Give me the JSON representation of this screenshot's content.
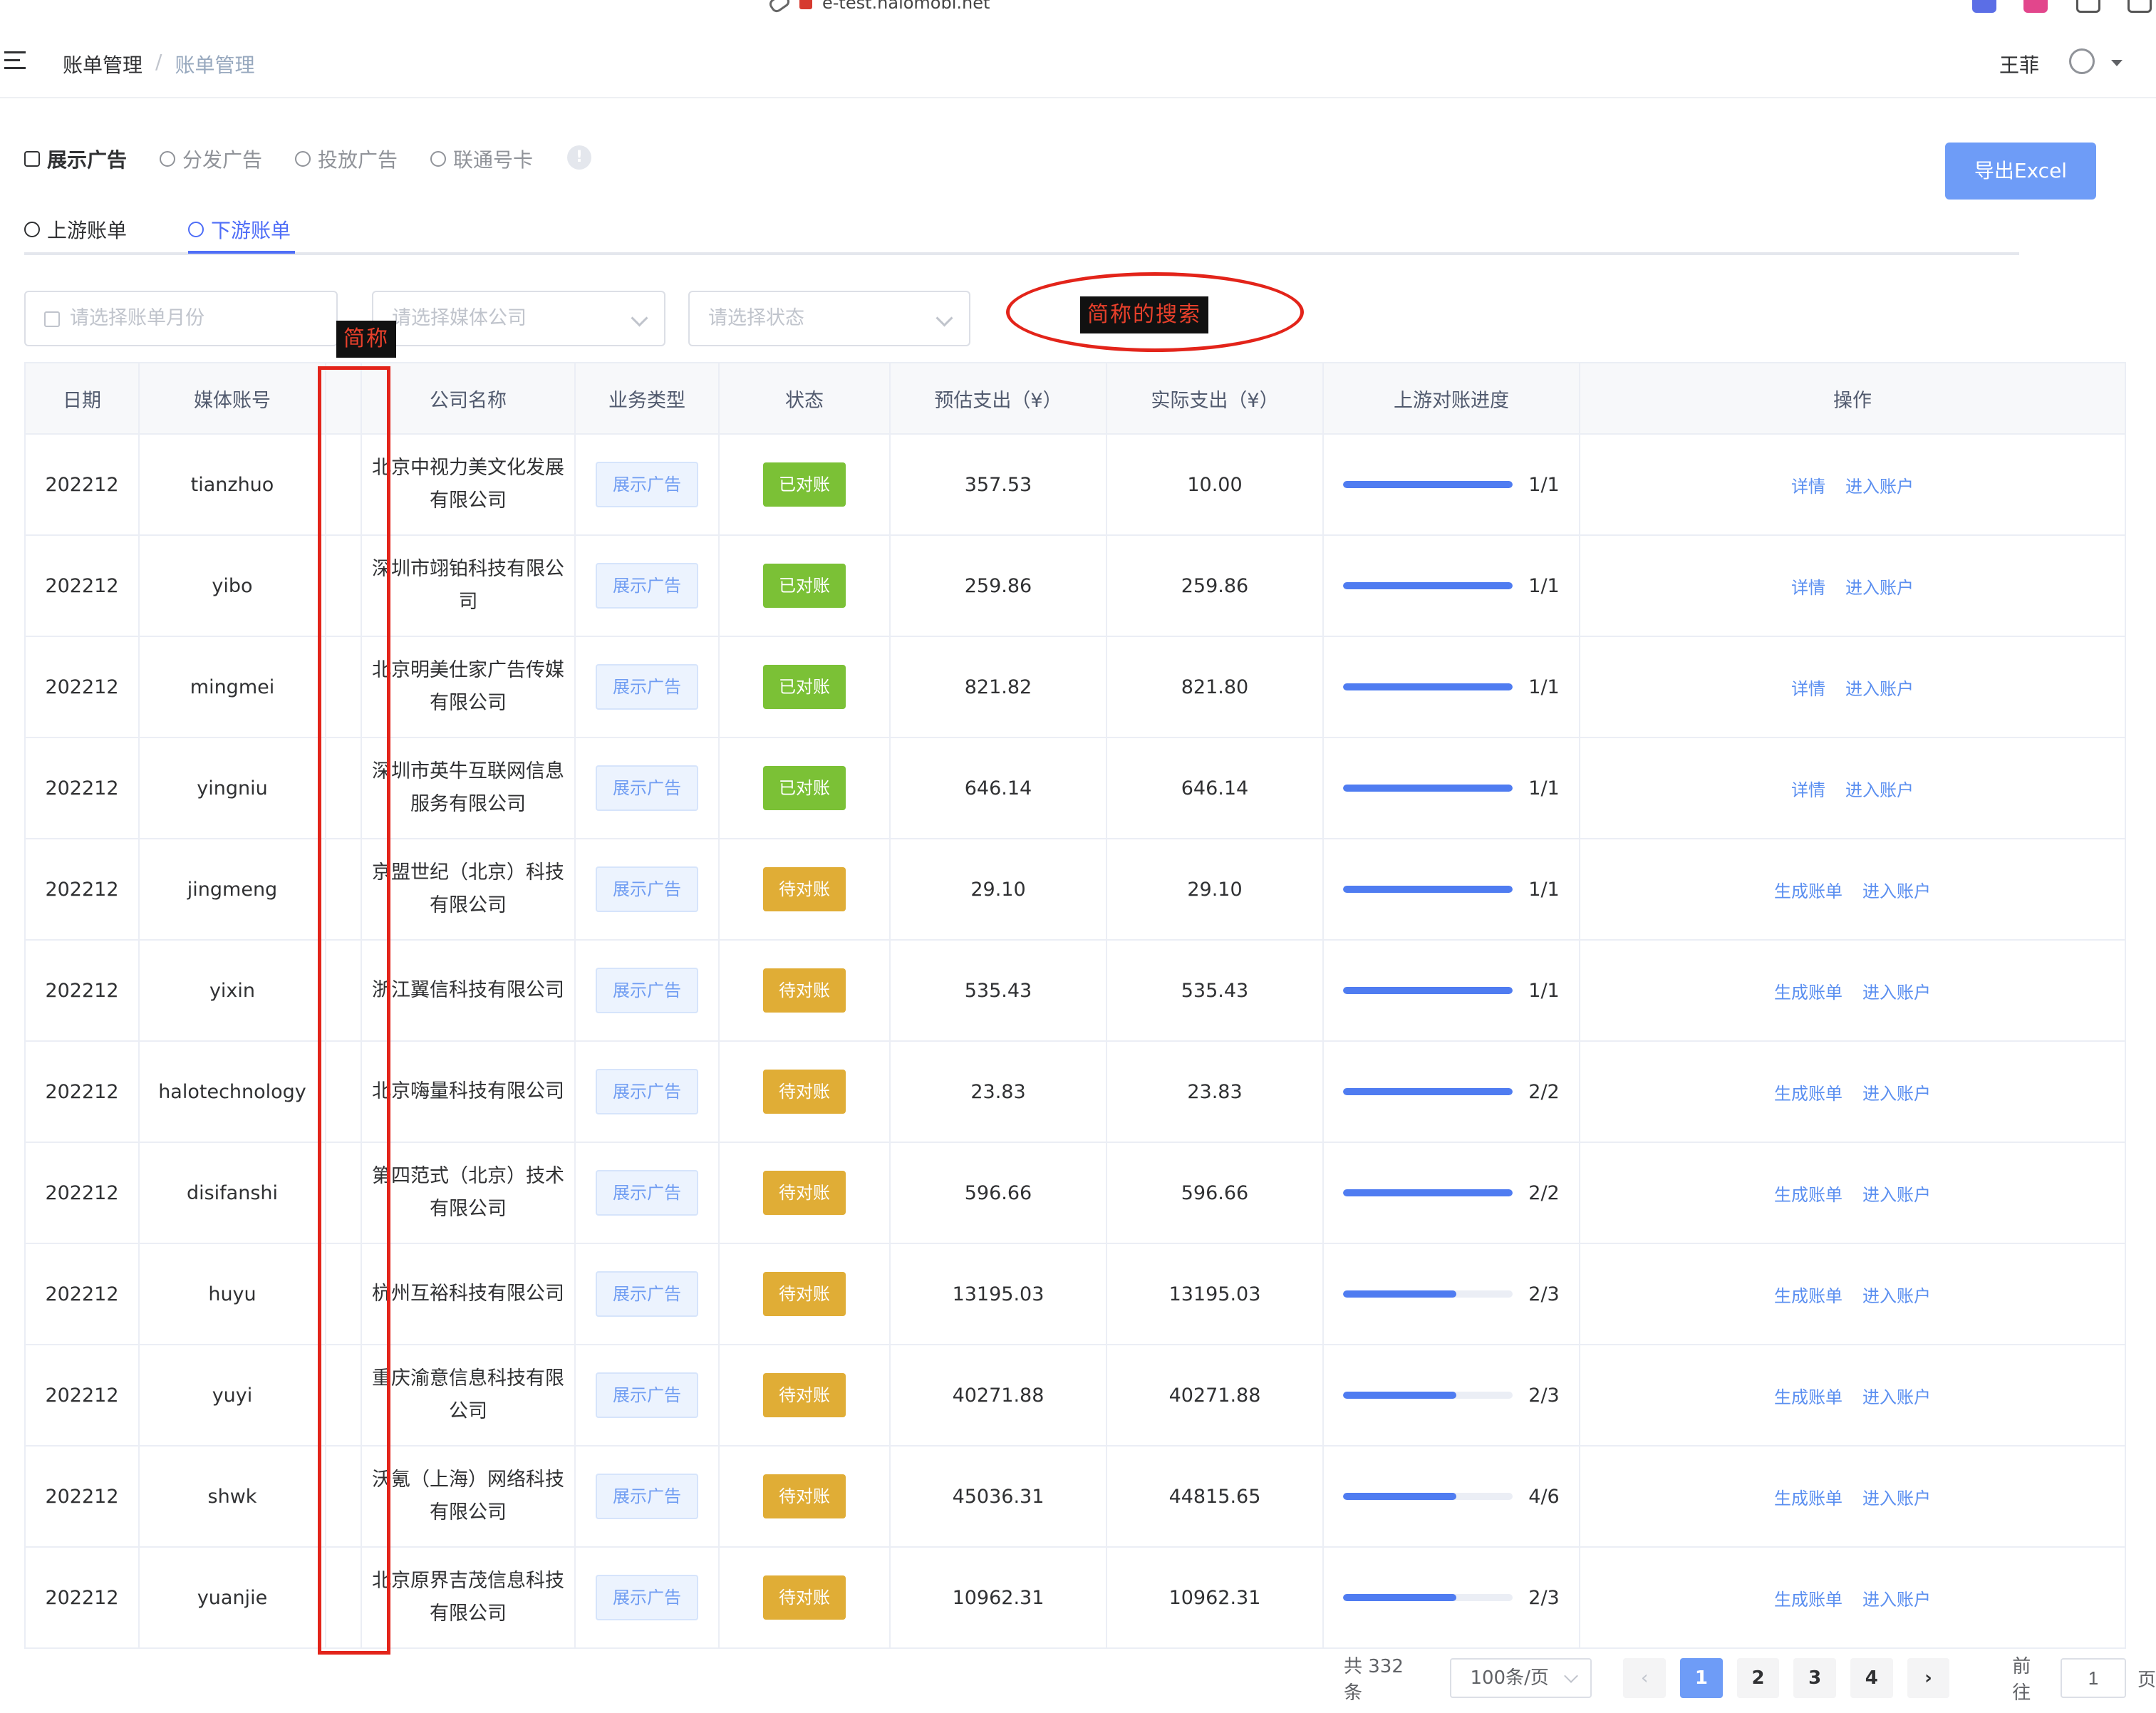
{
  "browser": {
    "url": "e-test.halomobi.net"
  },
  "header": {
    "breadcrumb": [
      "账单管理",
      "账单管理"
    ],
    "user_name": "王菲"
  },
  "top_tabs": [
    "展示广告",
    "分发广告",
    "投放广告",
    "联通号卡"
  ],
  "export_label": "导出Excel",
  "sub_tabs": [
    "上游账单",
    "下游账单"
  ],
  "filters": {
    "month_placeholder": "请选择账单月份",
    "media_placeholder": "请选择媒体公司",
    "status_placeholder": "请选择状态"
  },
  "annotations": {
    "search_label": "简称的搜索",
    "column_label": "简称"
  },
  "table": {
    "headers": [
      "日期",
      "媒体账号",
      "",
      "公司名称",
      "业务类型",
      "状态",
      "预估支出（¥）",
      "实际支出（¥）",
      "上游对账进度",
      "操作"
    ],
    "rows": [
      {
        "date": "202212",
        "account": "tianzhuo",
        "short": "",
        "company": "北京中视力美文化发展有限公司",
        "biz": "展示广告",
        "status": "已对账",
        "est": "357.53",
        "actual": "10.00",
        "progress": "1/1",
        "progress_ratio": 1.0,
        "ops": [
          "详情",
          "进入账户"
        ]
      },
      {
        "date": "202212",
        "account": "yibo",
        "short": "",
        "company": "深圳市翊铂科技有限公司",
        "biz": "展示广告",
        "status": "已对账",
        "est": "259.86",
        "actual": "259.86",
        "progress": "1/1",
        "progress_ratio": 1.0,
        "ops": [
          "详情",
          "进入账户"
        ]
      },
      {
        "date": "202212",
        "account": "mingmei",
        "short": "",
        "company": "北京明美仕家广告传媒有限公司",
        "biz": "展示广告",
        "status": "已对账",
        "est": "821.82",
        "actual": "821.80",
        "progress": "1/1",
        "progress_ratio": 1.0,
        "ops": [
          "详情",
          "进入账户"
        ]
      },
      {
        "date": "202212",
        "account": "yingniu",
        "short": "",
        "company": "深圳市英牛互联网信息服务有限公司",
        "biz": "展示广告",
        "status": "已对账",
        "est": "646.14",
        "actual": "646.14",
        "progress": "1/1",
        "progress_ratio": 1.0,
        "ops": [
          "详情",
          "进入账户"
        ]
      },
      {
        "date": "202212",
        "account": "jingmeng",
        "short": "",
        "company": "京盟世纪（北京）科技有限公司",
        "biz": "展示广告",
        "status": "待对账",
        "est": "29.10",
        "actual": "29.10",
        "progress": "1/1",
        "progress_ratio": 1.0,
        "ops": [
          "生成账单",
          "进入账户"
        ]
      },
      {
        "date": "202212",
        "account": "yixin",
        "short": "",
        "company": "浙江翼信科技有限公司",
        "biz": "展示广告",
        "status": "待对账",
        "est": "535.43",
        "actual": "535.43",
        "progress": "1/1",
        "progress_ratio": 1.0,
        "ops": [
          "生成账单",
          "进入账户"
        ]
      },
      {
        "date": "202212",
        "account": "halotechnology",
        "short": "",
        "company": "北京嗨量科技有限公司",
        "biz": "展示广告",
        "status": "待对账",
        "est": "23.83",
        "actual": "23.83",
        "progress": "2/2",
        "progress_ratio": 1.0,
        "ops": [
          "生成账单",
          "进入账户"
        ]
      },
      {
        "date": "202212",
        "account": "disifanshi",
        "short": "",
        "company": "第四范式（北京）技术有限公司",
        "biz": "展示广告",
        "status": "待对账",
        "est": "596.66",
        "actual": "596.66",
        "progress": "2/2",
        "progress_ratio": 1.0,
        "ops": [
          "生成账单",
          "进入账户"
        ]
      },
      {
        "date": "202212",
        "account": "huyu",
        "short": "",
        "company": "杭州互裕科技有限公司",
        "biz": "展示广告",
        "status": "待对账",
        "est": "13195.03",
        "actual": "13195.03",
        "progress": "2/3",
        "progress_ratio": 0.6667,
        "ops": [
          "生成账单",
          "进入账户"
        ]
      },
      {
        "date": "202212",
        "account": "yuyi",
        "short": "",
        "company": "重庆渝意信息科技有限公司",
        "biz": "展示广告",
        "status": "待对账",
        "est": "40271.88",
        "actual": "40271.88",
        "progress": "2/3",
        "progress_ratio": 0.6667,
        "ops": [
          "生成账单",
          "进入账户"
        ]
      },
      {
        "date": "202212",
        "account": "shwk",
        "short": "",
        "company": "沃氪（上海）网络科技有限公司",
        "biz": "展示广告",
        "status": "待对账",
        "est": "45036.31",
        "actual": "44815.65",
        "progress": "4/6",
        "progress_ratio": 0.6667,
        "ops": [
          "生成账单",
          "进入账户"
        ]
      },
      {
        "date": "202212",
        "account": "yuanjie",
        "short": "",
        "company": "北京原界吉茂信息科技有限公司",
        "biz": "展示广告",
        "status": "待对账",
        "est": "10962.31",
        "actual": "10962.31",
        "progress": "2/3",
        "progress_ratio": 0.6667,
        "ops": [
          "生成账单",
          "进入账户"
        ]
      }
    ]
  },
  "pagination": {
    "total": "共 332 条",
    "page_size": "100条/页",
    "pages": [
      "1",
      "2",
      "3",
      "4"
    ],
    "current": "1",
    "goto_label": "前往",
    "goto_value": "1",
    "page_suffix": "页"
  },
  "colors": {
    "primary": "#4f6ef7",
    "export_button": "#6e9cf7",
    "reconciled": "#7bc136",
    "pending": "#e0ad36",
    "annotation_red": "#e3241a",
    "progress": "#4f7cf1"
  }
}
